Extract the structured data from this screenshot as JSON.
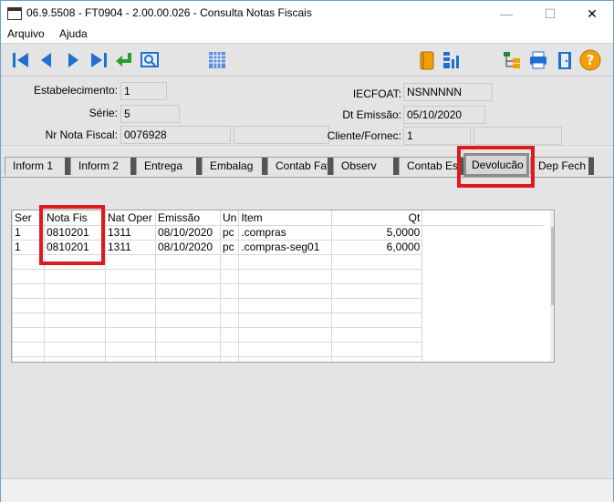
{
  "window": {
    "title": "06.9.5508 - FT0904 - 2.00.00.026 - Consulta Notas Fiscais",
    "controls": {
      "minimize": "—",
      "maximize": "☐",
      "close": "✕"
    }
  },
  "menu": {
    "items": [
      "Arquivo",
      "Ajuda"
    ]
  },
  "toolbar": {
    "buttons": [
      "first-icon",
      "previous-icon",
      "next-icon",
      "last-icon",
      "select-return-icon",
      "search-record-icon",
      "calendar-grid-icon",
      "notebook-icon",
      "report-chart-icon",
      "tree-structure-icon",
      "printer-icon",
      "exit-door-icon",
      "help-icon"
    ]
  },
  "header": {
    "estabelecimento_label": "Estabelecimento:",
    "estabelecimento_value": "1",
    "serie_label": "Série:",
    "serie_value": "5",
    "nr_nota_label": "Nr Nota Fiscal:",
    "nr_nota_value": "0076928",
    "iecfoat_label": "IECFOAT:",
    "iecfoat_value": "NSNNNNN",
    "dt_emissao_label": "Dt Emissão:",
    "dt_emissao_value": "05/10/2020",
    "cliente_label": "Cliente/Fornec:",
    "cliente_value": "1"
  },
  "tabs": [
    {
      "label": "Inform 1"
    },
    {
      "label": "Inform 2"
    },
    {
      "label": "Entrega"
    },
    {
      "label": "Embalag"
    },
    {
      "label": "Contab Fat"
    },
    {
      "label": "Observ"
    },
    {
      "label": "Contab Est"
    },
    {
      "label": "Devolucão"
    },
    {
      "label": "Dep Fech"
    }
  ],
  "active_tab": "Devolucão",
  "grid": {
    "columns": [
      "Ser",
      "Nota Fis",
      "Nat Oper",
      "Emissão",
      "Un",
      "Item",
      "Qt"
    ],
    "rows": [
      [
        "1",
        "0810201",
        "1311",
        "08/10/2020",
        "pc",
        ".compras",
        "5,0000"
      ],
      [
        "1",
        "0810201",
        "1311",
        "08/10/2020",
        "pc",
        ".compras-seg01",
        "6,0000"
      ]
    ]
  },
  "colors": {
    "highlight": "#e0191f",
    "panel": "#e4e4e4",
    "toolbar_blue": "#1e6fd0"
  }
}
